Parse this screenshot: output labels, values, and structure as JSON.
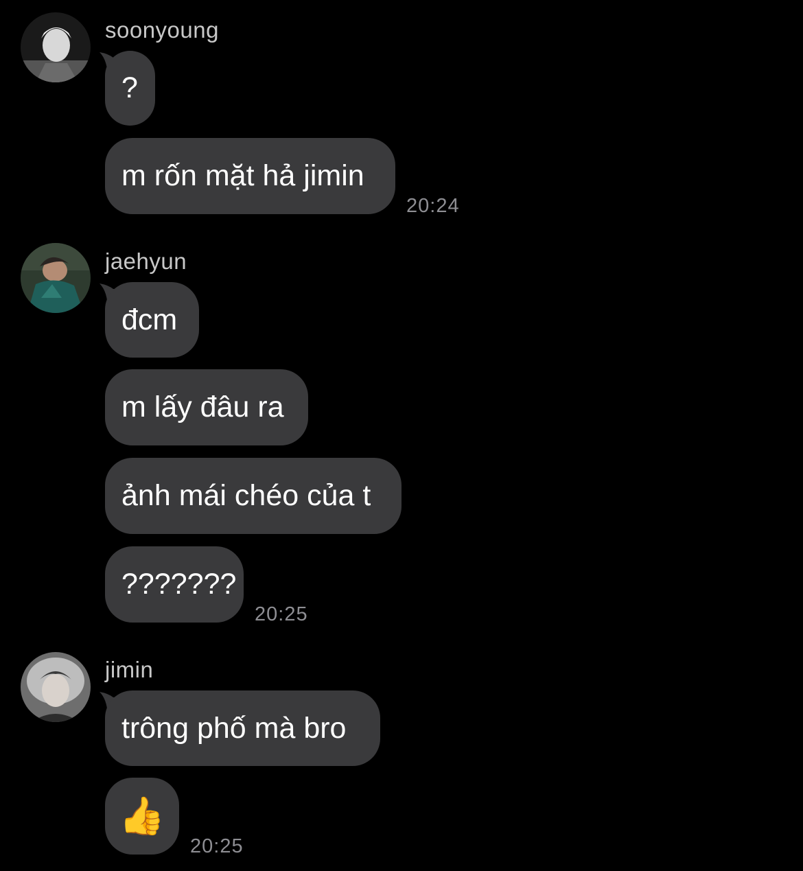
{
  "groups": [
    {
      "sender": "soonyoung",
      "avatar": "soonyoung-avatar",
      "messages": [
        "?",
        "m rốn mặt hả jimin"
      ],
      "time": "20:24"
    },
    {
      "sender": "jaehyun",
      "avatar": "jaehyun-avatar",
      "messages": [
        "đcm",
        "m lấy đâu ra",
        "ảnh mái chéo của t",
        "???????"
      ],
      "time": "20:25"
    },
    {
      "sender": "jimin",
      "avatar": "jimin-avatar",
      "messages": [
        "trông phố mà bro",
        "👍"
      ],
      "time": "20:25"
    }
  ],
  "colors": {
    "background": "#000000",
    "bubble": "#3a3a3c",
    "sender_text": "#c8c8c8",
    "timestamp": "#8e8e93"
  },
  "icons": [
    "thumbs-up-icon"
  ]
}
